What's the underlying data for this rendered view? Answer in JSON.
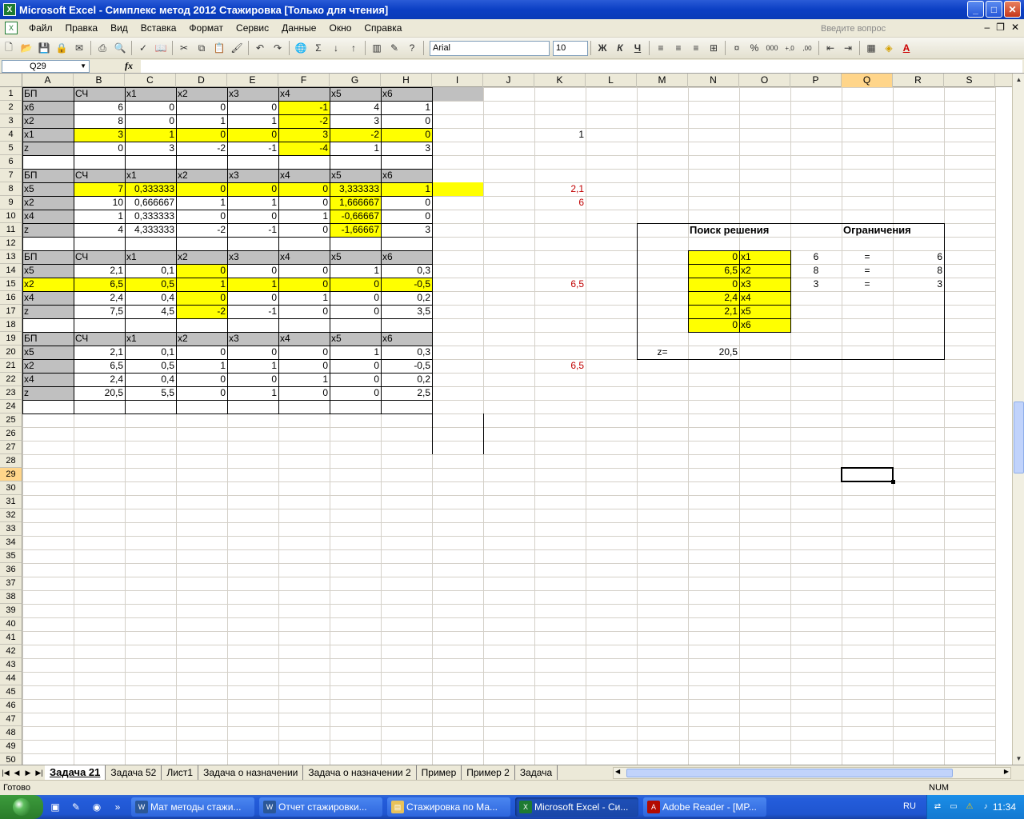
{
  "window": {
    "title": "Microsoft Excel - Симплекс метод 2012 Стажировка  [Только для чтения]"
  },
  "menu": {
    "items": [
      "Файл",
      "Правка",
      "Вид",
      "Вставка",
      "Формат",
      "Сервис",
      "Данные",
      "Окно",
      "Справка"
    ],
    "ask_placeholder": "Введите вопрос"
  },
  "toolbar": {
    "font_name": "Arial",
    "font_size": "10",
    "bold": "Ж",
    "italic": "К",
    "underline": "Ч"
  },
  "formula_bar": {
    "name_box": "Q29",
    "fx": "fx",
    "formula": ""
  },
  "columns": [
    "A",
    "B",
    "C",
    "D",
    "E",
    "F",
    "G",
    "H",
    "I",
    "J",
    "K",
    "L",
    "M",
    "N",
    "O",
    "P",
    "Q",
    "R",
    "S"
  ],
  "selected_column": "Q",
  "selected_row": 29,
  "colors": {
    "yellow": "#ffff00",
    "grey": "#c0c0c0",
    "red_text": "#c00000"
  },
  "cells": {
    "A1": "БП",
    "B1": "СЧ",
    "C1": "x1",
    "D1": "x2",
    "E1": "x3",
    "F1": "x4",
    "G1": "x5",
    "H1": "x6",
    "A2": "x6",
    "B2": "6",
    "C2": "0",
    "D2": "0",
    "E2": "0",
    "F2": "-1",
    "G2": "4",
    "H2": "1",
    "A3": "x2",
    "B3": "8",
    "C3": "0",
    "D3": "1",
    "E3": "1",
    "F3": "-2",
    "G3": "3",
    "H3": "0",
    "A4": "x1",
    "B4": "3",
    "C4": "1",
    "D4": "0",
    "E4": "0",
    "F4": "3",
    "G4": "-2",
    "H4": "0",
    "K4": "1",
    "A5": "z",
    "B5": "0",
    "C5": "3",
    "D5": "-2",
    "E5": "-1",
    "F5": "-4",
    "G5": "1",
    "H5": "3",
    "A7": "БП",
    "B7": "СЧ",
    "C7": "x1",
    "D7": "x2",
    "E7": "x3",
    "F7": "x4",
    "G7": "x5",
    "H7": "x6",
    "A8": "x5",
    "B8": "7",
    "C8": "0,333333",
    "D8": "0",
    "E8": "0",
    "F8": "0",
    "G8": "3,333333",
    "H8": "1",
    "K8": "2,1",
    "A9": "x2",
    "B9": "10",
    "C9": "0,666667",
    "D9": "1",
    "E9": "1",
    "F9": "0",
    "G9": "1,666667",
    "H9": "0",
    "K9": "6",
    "A10": "x4",
    "B10": "1",
    "C10": "0,333333",
    "D10": "0",
    "E10": "0",
    "F10": "1",
    "G10": "-0,66667",
    "H10": "0",
    "A11": "z",
    "B11": "4",
    "C11": "4,333333",
    "D11": "-2",
    "E11": "-1",
    "F11": "0",
    "G11": "-1,66667",
    "H11": "3",
    "A13": "БП",
    "B13": "СЧ",
    "C13": "x1",
    "D13": "x2",
    "E13": "x3",
    "F13": "x4",
    "G13": "x5",
    "H13": "x6",
    "A14": "x5",
    "B14": "2,1",
    "C14": "0,1",
    "D14": "0",
    "E14": "0",
    "F14": "0",
    "G14": "1",
    "H14": "0,3",
    "A15": "x2",
    "B15": "6,5",
    "C15": "0,5",
    "D15": "1",
    "E15": "1",
    "F15": "0",
    "G15": "0",
    "H15": "-0,5",
    "K15": "6,5",
    "A16": "x4",
    "B16": "2,4",
    "C16": "0,4",
    "D16": "0",
    "E16": "0",
    "F16": "1",
    "G16": "0",
    "H16": "0,2",
    "A17": "z",
    "B17": "7,5",
    "C17": "4,5",
    "D17": "-2",
    "E17": "-1",
    "F17": "0",
    "G17": "0",
    "H17": "3,5",
    "A19": "БП",
    "B19": "СЧ",
    "C19": "x1",
    "D19": "x2",
    "E19": "x3",
    "F19": "x4",
    "G19": "x5",
    "H19": "x6",
    "A20": "x5",
    "B20": "2,1",
    "C20": "0,1",
    "D20": "0",
    "E20": "0",
    "F20": "0",
    "G20": "1",
    "H20": "0,3",
    "A21": "x2",
    "B21": "6,5",
    "C21": "0,5",
    "D21": "1",
    "E21": "1",
    "F21": "0",
    "G21": "0",
    "H21": "-0,5",
    "K21": "6,5",
    "A22": "x4",
    "B22": "2,4",
    "C22": "0,4",
    "D22": "0",
    "E22": "0",
    "F22": "1",
    "G22": "0",
    "H22": "0,2",
    "A23": "z",
    "B23": "20,5",
    "C23": "5,5",
    "D23": "0",
    "E23": "1",
    "F23": "0",
    "G23": "0",
    "H23": "2,5",
    "N11": "Поиск решения",
    "Q11": "Ограничения",
    "N13": "0",
    "O13": "x1",
    "P13": "6",
    "Q13": "=",
    "R13": "6",
    "N14": "6,5",
    "O14": "x2",
    "P14": "8",
    "Q14": "=",
    "R14": "8",
    "N15": "0",
    "O15": "x3",
    "P15": "3",
    "Q15": "=",
    "R15": "3",
    "N16": "2,4",
    "O16": "x4",
    "N17": "2,1",
    "O17": "x5",
    "N18": "0",
    "O18": "x6",
    "M20": "z=",
    "N20": "20,5"
  },
  "sheet_tabs": [
    "Задача 21",
    "Задача 52",
    "Лист1",
    "Задача о назначении",
    "Задача о назначении 2",
    "Пример",
    "Пример 2",
    "Задача"
  ],
  "active_tab": "Задача 21",
  "status": {
    "text": "Готово",
    "num": "NUM"
  },
  "taskbar": {
    "tasks": [
      "Мат методы стажи...",
      "Отчет стажировки...",
      "Стажировка по Ма...",
      "Microsoft Excel - Си...",
      "Adobe Reader - [MP..."
    ],
    "active_task": "Microsoft Excel - Си...",
    "lang": "RU",
    "clock": "11:34"
  }
}
